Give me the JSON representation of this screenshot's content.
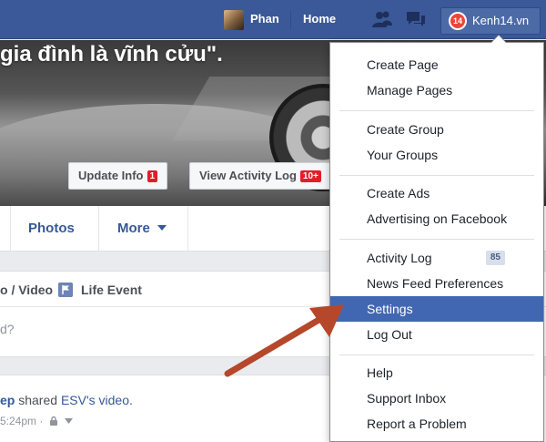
{
  "topbar": {
    "profile_name": "Phan",
    "home_label": "Home",
    "icons": [
      "friends-icon",
      "messages-icon"
    ],
    "account_logo_text": "14",
    "account_label": "Kenh14.vn",
    "brand_color": "#3b5998"
  },
  "cover": {
    "quote": "gia đình là vĩnh cửu\".",
    "update_info_label": "Update Info",
    "update_info_count": "1",
    "activity_log_label": "View Activity Log",
    "activity_log_count": "10+"
  },
  "tabs": {
    "photos": "Photos",
    "more": "More"
  },
  "composer": {
    "photo_video": "o / Video",
    "life_event": "Life Event",
    "prompt": "d?"
  },
  "post": {
    "author": "ep",
    "action": "shared",
    "target": "ESV's video",
    "target_suffix": ".",
    "time": "5:24pm ·"
  },
  "dropdown": {
    "groups": [
      [
        "Create Page",
        "Manage Pages"
      ],
      [
        "Create Group",
        "Your Groups"
      ],
      [
        "Create Ads",
        "Advertising on Facebook"
      ],
      [
        "Activity Log",
        "News Feed Preferences",
        "Settings",
        "Log Out"
      ],
      [
        "Help",
        "Support Inbox",
        "Report a Problem"
      ]
    ],
    "activity_log_count": "85",
    "highlighted": "Settings",
    "highlight_color": "#4267b2"
  },
  "annotation": {
    "arrow_color": "#b5472b"
  }
}
